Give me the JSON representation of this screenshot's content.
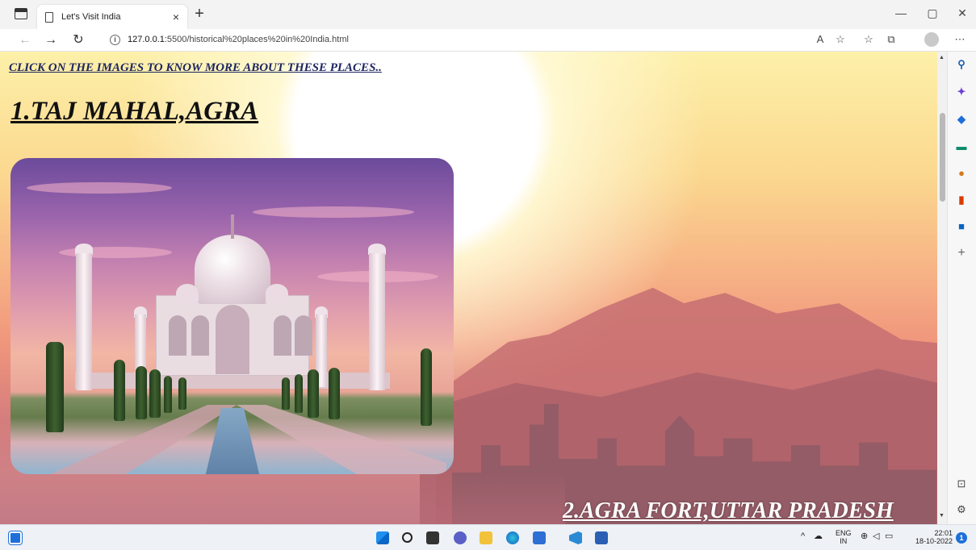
{
  "browser": {
    "tab_title": "Let's Visit India",
    "tab_close": "×",
    "new_tab": "+",
    "url_host": "127.0.0.1",
    "url_path": ":5500/historical%20places%20in%20India.html",
    "icons": [
      "back-icon",
      "forward-icon",
      "refresh-icon",
      "info-icon",
      "read-aloud-icon",
      "favorite-add-icon",
      "favorites-icon",
      "collections-icon",
      "profile-icon",
      "more-icon"
    ]
  },
  "window_controls": {
    "minimize": "—",
    "restore": "▢",
    "close": "✕"
  },
  "page": {
    "hint": "CLICK ON THE IMAGES TO KNOW MORE ABOUT THESE PLACES..",
    "heading_1": "1.TAJ MAHAL,AGRA",
    "heading_2": "2.AGRA FORT,UTTAR PRADESH",
    "image_1_alt": "Taj Mahal"
  },
  "sidebar": {
    "items": [
      "search-icon",
      "copilot-icon",
      "shopping-tag-icon",
      "tools-icon",
      "games-icon",
      "office-icon",
      "outlook-icon",
      "add-icon"
    ],
    "add_label": "+",
    "bottom": [
      "hide-sidebar-icon",
      "settings-icon"
    ]
  },
  "taskbar": {
    "lang": "ENG",
    "region": "IN",
    "time": "22:01",
    "date": "18-10-2022",
    "notifications": "1",
    "apps": [
      "start-icon",
      "search-icon",
      "task-view-icon",
      "chat-icon",
      "file-explorer-icon",
      "edge-icon",
      "store-icon",
      "vscode-icon",
      "word-icon"
    ]
  }
}
